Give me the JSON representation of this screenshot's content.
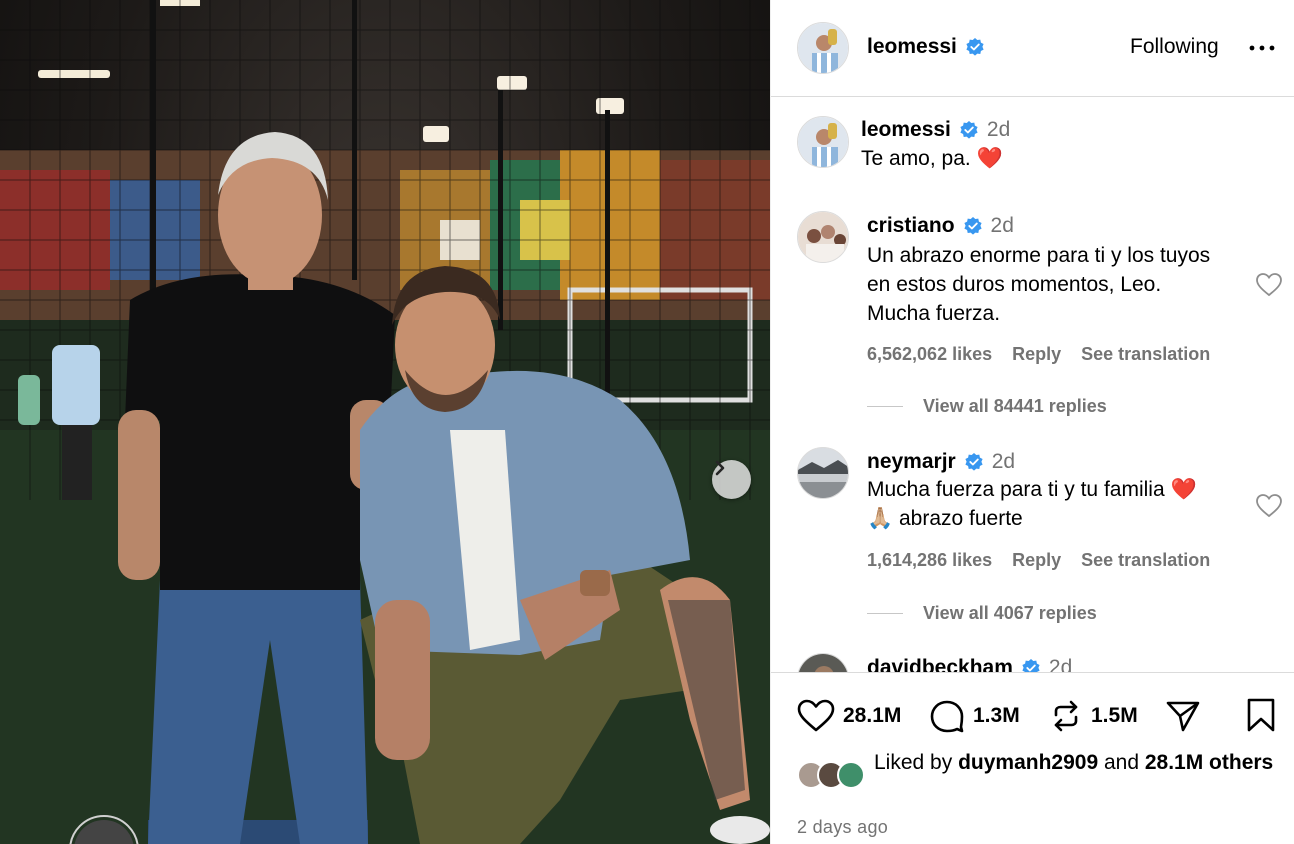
{
  "post": {
    "username": "leomessi",
    "follow_status": "Following",
    "more_label": "•••"
  },
  "caption": {
    "username": "leomessi",
    "time": "2d",
    "text": "Te amo, pa. ❤️"
  },
  "comments": [
    {
      "username": "cristiano",
      "time": "2d",
      "text": "Un abrazo enorme para ti y los tuyos en estos duros momentos, Leo. Mucha fuerza.",
      "likes": "6,562,062 likes",
      "reply": "Reply",
      "translate": "See translation",
      "view_replies": "View all 84441 replies"
    },
    {
      "username": "neymarjr",
      "time": "2d",
      "text": "Mucha fuerza para ti y tu familia ❤️ 🙏🏼 abrazo fuerte",
      "likes": "1,614,286 likes",
      "reply": "Reply",
      "translate": "See translation",
      "view_replies": "View all 4067 replies"
    },
    {
      "username": "davidbeckham",
      "time": "2d"
    }
  ],
  "actions": {
    "likes": "28.1M",
    "comments": "1.3M",
    "reposts": "1.5M"
  },
  "liked_by": {
    "prefix": "Liked by ",
    "user": "duymanh2909",
    "middle": " and ",
    "count": "28.1M others"
  },
  "posted": "2 days ago",
  "colors": {
    "verified": "#3897f0",
    "secondary_text": "#737373",
    "divider": "#dbdbdb"
  }
}
